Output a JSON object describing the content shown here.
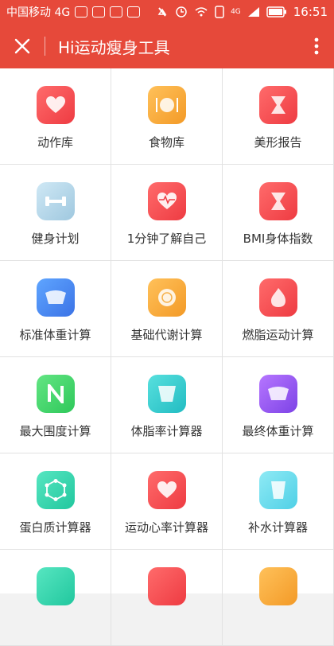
{
  "status_bar": {
    "carrier": "中国移动 4G",
    "signal": "4G",
    "time": "16:51"
  },
  "app_bar": {
    "title": "Hi运动瘦身工具"
  },
  "tools": [
    {
      "label": "动作库",
      "icon": "heart-icon"
    },
    {
      "label": "食物库",
      "icon": "plate-icon"
    },
    {
      "label": "美形报告",
      "icon": "hourglass-icon"
    },
    {
      "label": "健身计划",
      "icon": "dumbbell-icon"
    },
    {
      "label": "1分钟了解自己",
      "icon": "heart-monitor-icon"
    },
    {
      "label": "BMI身体指数",
      "icon": "hourglass-icon"
    },
    {
      "label": "标准体重计算",
      "icon": "scale-icon"
    },
    {
      "label": "基础代谢计算",
      "icon": "lemon-icon"
    },
    {
      "label": "燃脂运动计算",
      "icon": "flame-icon"
    },
    {
      "label": "最大围度计算",
      "icon": "n-icon"
    },
    {
      "label": "体脂率计算器",
      "icon": "body-fat-icon"
    },
    {
      "label": "最终体重计算",
      "icon": "scale-icon"
    },
    {
      "label": "蛋白质计算器",
      "icon": "molecule-icon"
    },
    {
      "label": "运动心率计算器",
      "icon": "heart-rate-icon"
    },
    {
      "label": "补水计算器",
      "icon": "water-glass-icon"
    },
    {
      "label": "",
      "icon": "partial-icon"
    },
    {
      "label": "",
      "icon": "partial-icon"
    },
    {
      "label": "",
      "icon": "partial-icon"
    }
  ]
}
